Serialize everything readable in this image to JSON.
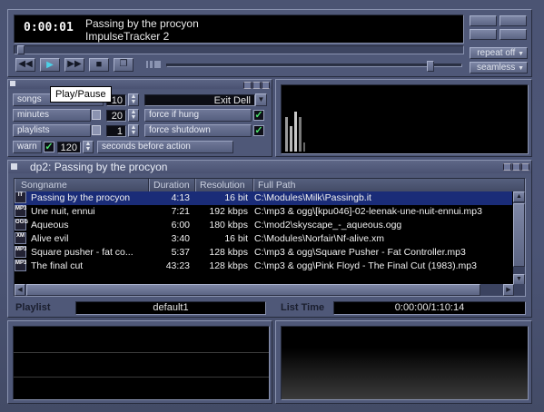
{
  "player": {
    "time": "0:00:01",
    "track_title": "Passing by the procyon",
    "track_sub": "ImpulseTracker 2",
    "repeat_label": "repeat off",
    "seamless_label": "seamless",
    "seek": 0.01,
    "volume": 0.9
  },
  "tooltip": "Play/Pause",
  "options": {
    "songs_label": "songs",
    "songs_value": "10",
    "minutes_label": "minutes",
    "minutes_value": "20",
    "playlists_label": "playlists",
    "playlists_value": "1",
    "warn_label": "warn",
    "warn_value": "120",
    "warn_suffix": "seconds before action",
    "exit_option": "Exit Dell",
    "force_hung": "force if hung",
    "force_shutdown": "force shutdown"
  },
  "playlist": {
    "window_title": "dp2: Passing by the procyon",
    "columns": [
      "Songname",
      "Duration",
      "Resolution",
      "Full Path"
    ],
    "rows": [
      {
        "badge": "IT",
        "name": "Passing by the procyon",
        "duration": "4:13",
        "res": "16 bit",
        "path": "C:\\Modules\\Milk\\Passingb.it",
        "selected": true
      },
      {
        "badge": "MP3",
        "name": "Une nuit, ennui",
        "duration": "7:21",
        "res": "192 kbps",
        "path": "C:\\mp3 & ogg\\[kpu046]-02-leenak-une-nuit-ennui.mp3"
      },
      {
        "badge": "OGG",
        "name": "Aqueous",
        "duration": "6:00",
        "res": "180 kbps",
        "path": "C:\\mod2\\skyscape_-_aqueous.ogg"
      },
      {
        "badge": "XM",
        "name": "Alive evil",
        "duration": "3:40",
        "res": "16 bit",
        "path": "C:\\Modules\\Norfair\\Nf-alive.xm"
      },
      {
        "badge": "MP3",
        "name": "Square pusher - fat co...",
        "duration": "5:37",
        "res": "128 kbps",
        "path": "C:\\mp3 & ogg\\Square Pusher - Fat Controller.mp3"
      },
      {
        "badge": "MP3",
        "name": "The final cut",
        "duration": "43:23",
        "res": "128 kbps",
        "path": "C:\\mp3 & ogg\\Pink Floyd - The Final Cut (1983).mp3"
      }
    ],
    "playlist_label": "Playlist",
    "playlist_name": "default1",
    "listtime_label": "List Time",
    "listtime_value": "0:00:00/1:10:14"
  },
  "colors": {
    "bg": "#4b5475",
    "lcd": "#000000",
    "selection": "#1a2c78",
    "check": "#4ce06c"
  }
}
